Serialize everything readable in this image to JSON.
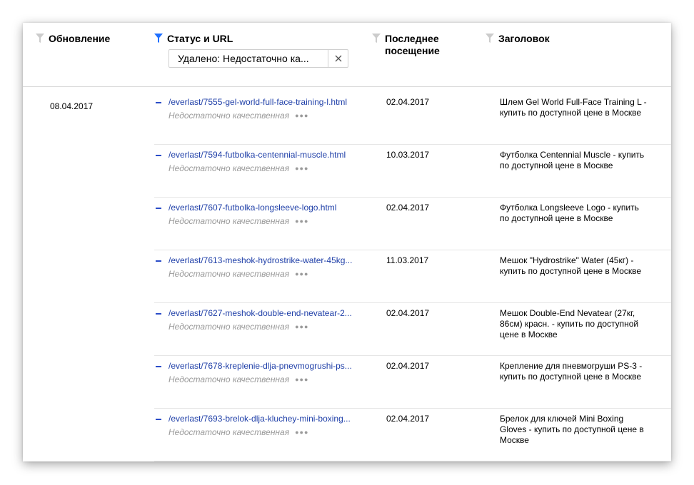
{
  "header": {
    "col_update": "Обновление",
    "col_status_url": "Статус и URL",
    "col_last_visit": "Последнее посещение",
    "col_title": "Заголовок",
    "filter_value": "Удалено: Недостаточно ка...",
    "colors": {
      "funnel_active": "#1f6fff",
      "funnel_inactive": "#cccccc",
      "link": "#1f3fa8"
    }
  },
  "group_date": "08.04.2017",
  "rows": [
    {
      "url": "/everlast/7555-gel-world-full-face-training-l.html",
      "status": "Недостаточно качественная",
      "visit": "02.04.2017",
      "title": "Шлем Gel World Full-Face Training L - купить по доступной цене в Москве"
    },
    {
      "url": "/everlast/7594-futbolka-centennial-muscle.html",
      "status": "Недостаточно качественная",
      "visit": "10.03.2017",
      "title": "Футболка Centennial Muscle - купить по доступной цене в Москве"
    },
    {
      "url": "/everlast/7607-futbolka-longsleeve-logo.html",
      "status": "Недостаточно качественная",
      "visit": "02.04.2017",
      "title": "Футболка Longsleeve Logo - купить по доступной цене в Москве"
    },
    {
      "url": "/everlast/7613-meshok-hydrostrike-water-45kg...",
      "status": "Недостаточно качественная",
      "visit": "11.03.2017",
      "title": "Мешок \"Hydrostrike\" Water (45кг) - купить по доступной цене в Москве"
    },
    {
      "url": "/everlast/7627-meshok-double-end-nevatear-2...",
      "status": "Недостаточно качественная",
      "visit": "02.04.2017",
      "title": "Мешок Double-End Nevatear (27кг, 86см) красн. - купить по доступной цене в Москве"
    },
    {
      "url": "/everlast/7678-kreplenie-dlja-pnevmogrushi-ps...",
      "status": "Недостаточно качественная",
      "visit": "02.04.2017",
      "title": "Крепление для пневмогруши PS-3 - купить по доступной цене в Москве"
    },
    {
      "url": "/everlast/7693-brelok-dlja-kluchey-mini-boxing...",
      "status": "Недостаточно качественная",
      "visit": "02.04.2017",
      "title": "Брелок для ключей Mini Boxing Gloves - купить по доступной цене в Москве"
    }
  ]
}
